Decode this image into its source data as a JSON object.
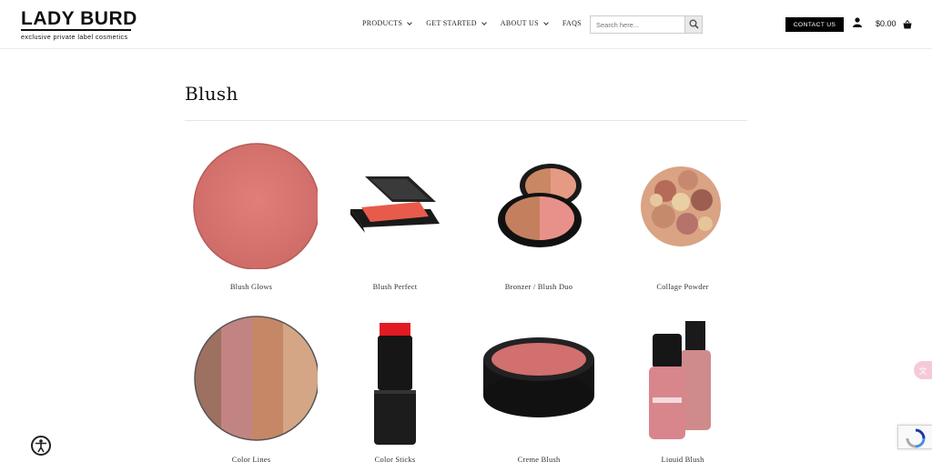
{
  "logo": {
    "main": "LADY BURD",
    "sub": "exclusive private label cosmetics"
  },
  "nav": [
    {
      "label": "PRODUCTS",
      "has_dropdown": true
    },
    {
      "label": "GET STARTED",
      "has_dropdown": true
    },
    {
      "label": "ABOUT US",
      "has_dropdown": true
    },
    {
      "label": "FAQS",
      "has_dropdown": false
    }
  ],
  "search": {
    "placeholder": "Search here..."
  },
  "header": {
    "contact_label": "CONTACT US",
    "cart_total": "$0.00"
  },
  "page": {
    "title": "Blush"
  },
  "products": [
    {
      "name": "Blush Glows",
      "icon": "blush-glows-image"
    },
    {
      "name": "Blush Perfect",
      "icon": "blush-perfect-image"
    },
    {
      "name": "Bronzer / Blush Duo",
      "icon": "bronzer-blush-duo-image"
    },
    {
      "name": "Collage Powder",
      "icon": "collage-powder-image"
    },
    {
      "name": "Color Lines",
      "icon": "color-lines-image"
    },
    {
      "name": "Color Sticks",
      "icon": "color-sticks-image"
    },
    {
      "name": "Creme Blush",
      "icon": "creme-blush-image"
    },
    {
      "name": "Liquid Blush",
      "icon": "liquid-blush-image"
    }
  ],
  "colors": {
    "accent": "#000000",
    "blush": "#d9766f",
    "pink_tab": "#f6c9d8"
  }
}
